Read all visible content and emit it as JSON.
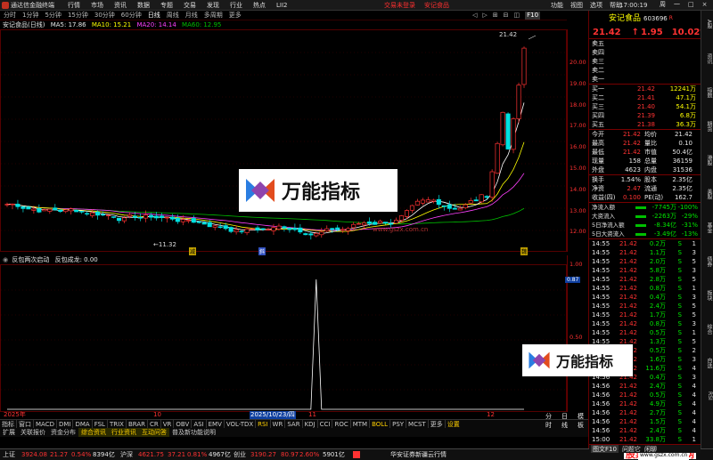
{
  "titlebar": {
    "app": "通达信金融终端",
    "menu": [
      "行情",
      "市场",
      "资讯",
      "数据",
      "专题",
      "交易",
      "发现",
      "行业",
      "热点",
      "LII2"
    ],
    "login": "交易未登录",
    "stock": "安记食品",
    "rightmenu": [
      "功能",
      "视图",
      "选项",
      "帮助"
    ],
    "clock": "17:00:19",
    "winbtns": [
      "周",
      "一",
      "□",
      "×"
    ]
  },
  "periods": [
    "分时",
    "1分钟",
    "5分钟",
    "15分钟",
    "30分钟",
    "60分钟",
    "日线",
    "周线",
    "月线",
    "多周期",
    "更多"
  ],
  "period_icons": [
    "◁",
    "▷",
    "⊞",
    "⊟",
    "◫",
    "F10"
  ],
  "mabar": {
    "name": "安记食品(日线)",
    "ma5": "MA5: 17.86",
    "ma10": "MA10: 15.21",
    "ma20": "MA20: 14.14",
    "ma60": "MA60: 12.95"
  },
  "main_chart": {
    "high_label": "21.42",
    "low_label": "←11.32",
    "price_ticks": [
      "20.00",
      "19.00",
      "18.00",
      "17.00",
      "16.00",
      "15.00",
      "14.00",
      "13.00",
      "12.00"
    ],
    "marks": [
      "减",
      "斜",
      "魏"
    ]
  },
  "indicator": {
    "label": "反包两次启动",
    "value": "反包成龙: 0.00",
    "axis_value": "0.87",
    "axis_ticks": [
      "1.00",
      "0.50"
    ]
  },
  "dates": {
    "year": "2025年",
    "d1": "10",
    "d2": "2025/10/23/四",
    "d3": "11",
    "d4": "12"
  },
  "tabs": [
    "指标",
    "窗口",
    "MACD",
    "DMI",
    "DMA",
    "FSL",
    "TRIX",
    "BRAR",
    "CR",
    "VR",
    "OBV",
    "ASI",
    "EMV",
    "VOL-TDX",
    "RSI",
    "WR",
    "SAR",
    "KDJ",
    "CCI",
    "ROC",
    "MTM",
    "BOLL",
    "PSY",
    "MCST",
    "更多",
    "设置"
  ],
  "tabs2": [
    "扩展",
    "关联报价",
    "资金分布",
    "综合资讯",
    "行业资讯",
    "互动问答",
    "普及新功能说明"
  ],
  "tabs_right": [
    "分时",
    "日线",
    "模板"
  ],
  "status": {
    "sh_name": "上证",
    "sh_val": "3924.08",
    "sh_chg": "21.27",
    "sh_pct": "0.54%",
    "sh_amt": "8394亿",
    "sz_name": "沪深",
    "sz_val": "4621.75",
    "sz_chg": "37.21",
    "sz_pct": "0.81%",
    "sz_amt": "4967亿",
    "cy_name": "创业",
    "cy_val": "3190.27",
    "cy_chg": "80.97",
    "cy_pct": "2.60%",
    "cy_amt": "5901亿",
    "broker": "华安证券新疆云行情",
    "watermark": "股票公式指标网",
    "url": "www.gszx.com.cn"
  },
  "watermark": {
    "text": "万能指标",
    "site": "www.gszx.com.cn"
  },
  "quote": {
    "name": "安记食品",
    "code": "603696",
    "badge": "R",
    "price": "21.42",
    "arrow": "↑",
    "chg": "1.95",
    "pct": "10.02%",
    "asks": [
      {
        "l": "卖五",
        "p": "",
        "v": ""
      },
      {
        "l": "卖四",
        "p": "",
        "v": ""
      },
      {
        "l": "卖三",
        "p": "",
        "v": ""
      },
      {
        "l": "卖二",
        "p": "",
        "v": ""
      },
      {
        "l": "卖一",
        "p": "",
        "v": ""
      }
    ],
    "bids": [
      {
        "l": "买一",
        "p": "21.42",
        "v": "12241万"
      },
      {
        "l": "买二",
        "p": "21.41",
        "v": "47.1万"
      },
      {
        "l": "买三",
        "p": "21.40",
        "v": "54.1万"
      },
      {
        "l": "买四",
        "p": "21.39",
        "v": "6.8万"
      },
      {
        "l": "买五",
        "p": "21.38",
        "v": "36.3万"
      }
    ],
    "stats": [
      [
        "今开",
        "21.42",
        "均价",
        "21.42"
      ],
      [
        "最高",
        "21.42",
        "量比",
        "0.10"
      ],
      [
        "最低",
        "21.42",
        "市值",
        "50.4亿"
      ],
      [
        "现量",
        "158",
        "总量",
        "36159"
      ],
      [
        "外盘",
        "4623",
        "内盘",
        "31536"
      ]
    ],
    "stats2": [
      [
        "换手",
        "1.54%",
        "股本",
        "2.35亿"
      ],
      [
        "净资",
        "2.47",
        "流通",
        "2.35亿"
      ],
      [
        "收益(四)",
        "0.100",
        "PE(动)",
        "162.7"
      ]
    ],
    "flows": [
      [
        "净流入额",
        "-7745万",
        "-100%"
      ],
      [
        "大资流入",
        "-2263万",
        "-29%"
      ],
      [
        "5日净流入额",
        "-8.34亿",
        "-31%"
      ],
      [
        "5日大资流入",
        "-3.49亿",
        "-13%"
      ]
    ],
    "ticks": [
      [
        "14:55",
        "21.42",
        "0.2万",
        "S",
        "1"
      ],
      [
        "14:55",
        "21.42",
        "1.1万",
        "S",
        "3"
      ],
      [
        "14:55",
        "21.42",
        "2.0万",
        "S",
        "5"
      ],
      [
        "14:55",
        "21.42",
        "5.8万",
        "S",
        "3"
      ],
      [
        "14:55",
        "21.42",
        "2.8万",
        "S",
        "5"
      ],
      [
        "14:55",
        "21.42",
        "0.8万",
        "S",
        "1"
      ],
      [
        "14:55",
        "21.42",
        "0.4万",
        "S",
        "3"
      ],
      [
        "14:55",
        "21.42",
        "2.4万",
        "S",
        "5"
      ],
      [
        "14:55",
        "21.42",
        "1.7万",
        "S",
        "5"
      ],
      [
        "14:55",
        "21.42",
        "0.8万",
        "S",
        "3"
      ],
      [
        "14:55",
        "21.42",
        "0.5万",
        "S",
        "1"
      ],
      [
        "14:55",
        "21.42",
        "1.3万",
        "S",
        "5"
      ],
      [
        "14:55",
        "21.42",
        "0.5万",
        "S",
        "2"
      ],
      [
        "14:56",
        "21.42",
        "1.6万",
        "S",
        "3"
      ],
      [
        "14:56",
        "21.42",
        "11.6万",
        "S",
        "4"
      ],
      [
        "14:56",
        "21.42",
        "0.4万",
        "S",
        "3"
      ],
      [
        "14:56",
        "21.42",
        "2.4万",
        "S",
        "4"
      ],
      [
        "14:56",
        "21.42",
        "0.5万",
        "S",
        "4"
      ],
      [
        "14:56",
        "21.42",
        "4.9万",
        "S",
        "4"
      ],
      [
        "14:56",
        "21.42",
        "2.7万",
        "S",
        "4"
      ],
      [
        "14:56",
        "21.42",
        "1.5万",
        "S",
        "4"
      ],
      [
        "14:56",
        "21.42",
        "2.4万",
        "S",
        "4"
      ],
      [
        "15:00",
        "21.42",
        "33.8万",
        "S",
        "1"
      ]
    ],
    "tabs": [
      "图文F10",
      "问题它",
      "闲聊"
    ]
  },
  "sidebar": [
    "A股",
    "资讯",
    "指数",
    "期货",
    "港股",
    "美股",
    "基金",
    "债券",
    "板块",
    "综合",
    "自选",
    "RSI"
  ],
  "colors": {
    "up": "#ff3232",
    "down": "#00e0e0",
    "ma5": "#ffffff",
    "ma10": "#ffff00",
    "ma20": "#ff40ff",
    "ma60": "#00c000"
  }
}
